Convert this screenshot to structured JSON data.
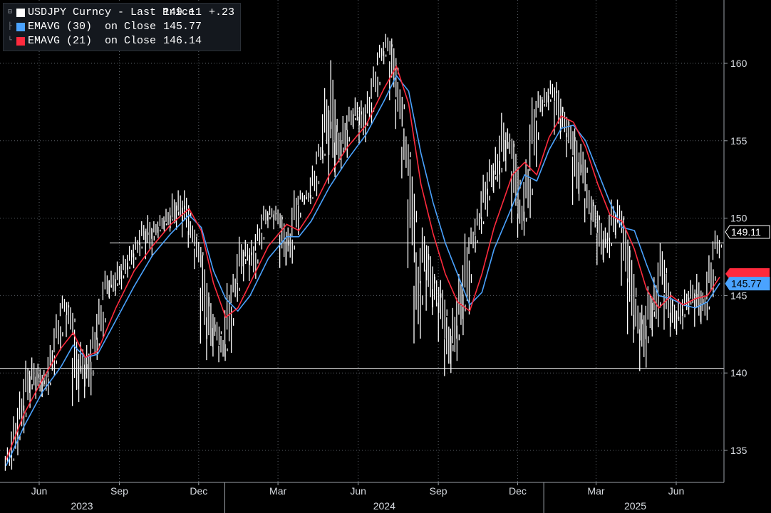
{
  "legend": {
    "rows": [
      {
        "name": "USDJPY Curncy - Last Price",
        "value": "149.11",
        "change": "+.23",
        "color": "#ffffff"
      },
      {
        "name": "EMAVG (30)  on Close",
        "value": "145.77",
        "change": "",
        "color": "#4aa3ff"
      },
      {
        "name": "EMAVG (21)  on Close",
        "value": "146.14",
        "change": "",
        "color": "#ff2a3d"
      }
    ]
  },
  "price_tag": {
    "last": "149.11",
    "ema30": "145.77"
  },
  "chart_data": {
    "type": "line",
    "title": "",
    "xlabel": "",
    "ylabel": "",
    "ylim": [
      133,
      163
    ],
    "y_ticks": [
      135,
      140,
      145,
      150,
      155,
      160
    ],
    "x_month_ticks": [
      {
        "label": "Jun",
        "date": "2023-06-01"
      },
      {
        "label": "Sep",
        "date": "2023-09-01"
      },
      {
        "label": "Dec",
        "date": "2023-12-01"
      },
      {
        "label": "Mar",
        "date": "2024-03-01"
      },
      {
        "label": "Jun",
        "date": "2024-06-01"
      },
      {
        "label": "Sep",
        "date": "2024-09-01"
      },
      {
        "label": "Dec",
        "date": "2024-12-01"
      },
      {
        "label": "Mar",
        "date": "2025-03-01"
      },
      {
        "label": "Jun",
        "date": "2025-06-01"
      }
    ],
    "x_year_labels": [
      {
        "label": "2023",
        "date": "2023-07-20"
      },
      {
        "label": "2024",
        "date": "2024-07-01"
      },
      {
        "label": "2025",
        "date": "2025-04-15"
      }
    ],
    "x_range": [
      "2023-04-24",
      "2025-07-31"
    ],
    "reference_lines": [
      148.4,
      140.3
    ],
    "grid": true,
    "legend_position": "top-left",
    "series": [
      {
        "name": "USDJPY Curncy - Last Price",
        "style": "hi-lo bars",
        "color": "#ffffff",
        "points": [
          [
            "2023-04-28",
            135.2,
            133.6
          ],
          [
            "2023-05-05",
            137.2,
            134.4
          ],
          [
            "2023-05-12",
            138.8,
            135.8
          ],
          [
            "2023-05-19",
            140.8,
            137.4
          ],
          [
            "2023-05-26",
            141.0,
            138.6
          ],
          [
            "2023-06-02",
            140.6,
            138.2
          ],
          [
            "2023-06-09",
            140.2,
            138.4
          ],
          [
            "2023-06-16",
            141.8,
            139.6
          ],
          [
            "2023-06-23",
            143.8,
            141.2
          ],
          [
            "2023-06-30",
            145.0,
            143.6
          ],
          [
            "2023-07-07",
            144.6,
            142.2
          ],
          [
            "2023-07-14",
            142.8,
            137.6
          ],
          [
            "2023-07-21",
            142.0,
            138.8
          ],
          [
            "2023-07-28",
            141.8,
            138.2
          ],
          [
            "2023-08-04",
            143.0,
            140.6
          ],
          [
            "2023-08-11",
            144.8,
            142.0
          ],
          [
            "2023-08-18",
            146.6,
            144.6
          ],
          [
            "2023-08-25",
            146.6,
            144.8
          ],
          [
            "2023-09-01",
            147.2,
            145.2
          ],
          [
            "2023-09-08",
            147.6,
            146.0
          ],
          [
            "2023-09-15",
            148.2,
            146.6
          ],
          [
            "2023-09-22",
            148.8,
            147.4
          ],
          [
            "2023-09-29",
            149.8,
            148.2
          ],
          [
            "2023-10-06",
            150.2,
            147.2
          ],
          [
            "2023-10-13",
            149.8,
            148.6
          ],
          [
            "2023-10-20",
            150.2,
            149.0
          ],
          [
            "2023-10-27",
            150.6,
            149.2
          ],
          [
            "2023-11-03",
            151.6,
            149.0
          ],
          [
            "2023-11-10",
            151.8,
            149.6
          ],
          [
            "2023-11-17",
            151.8,
            148.6
          ],
          [
            "2023-11-24",
            149.8,
            148.0
          ],
          [
            "2023-12-01",
            148.8,
            146.6
          ],
          [
            "2023-12-08",
            147.6,
            141.6
          ],
          [
            "2023-12-15",
            145.2,
            140.6
          ],
          [
            "2023-12-22",
            143.6,
            141.6
          ],
          [
            "2023-12-29",
            142.4,
            140.6
          ],
          [
            "2024-01-05",
            145.8,
            140.8
          ],
          [
            "2024-01-12",
            146.4,
            144.4
          ],
          [
            "2024-01-19",
            148.8,
            145.6
          ],
          [
            "2024-01-26",
            148.6,
            146.8
          ],
          [
            "2024-02-02",
            148.6,
            145.8
          ],
          [
            "2024-02-09",
            149.6,
            147.8
          ],
          [
            "2024-02-16",
            150.8,
            149.2
          ],
          [
            "2024-02-23",
            150.8,
            149.8
          ],
          [
            "2024-03-01",
            150.8,
            149.2
          ],
          [
            "2024-03-08",
            150.2,
            146.6
          ],
          [
            "2024-03-15",
            149.4,
            146.8
          ],
          [
            "2024-03-22",
            151.8,
            148.6
          ],
          [
            "2024-03-29",
            151.8,
            150.8
          ],
          [
            "2024-04-05",
            151.8,
            150.8
          ],
          [
            "2024-04-12",
            153.4,
            151.2
          ],
          [
            "2024-04-19",
            154.8,
            153.4
          ],
          [
            "2024-04-26",
            158.4,
            153.6
          ],
          [
            "2024-05-03",
            160.2,
            151.8
          ],
          [
            "2024-05-10",
            156.0,
            152.8
          ],
          [
            "2024-05-17",
            156.6,
            153.6
          ],
          [
            "2024-05-24",
            157.2,
            155.6
          ],
          [
            "2024-05-31",
            157.8,
            155.8
          ],
          [
            "2024-06-07",
            157.6,
            154.6
          ],
          [
            "2024-06-14",
            158.2,
            155.8
          ],
          [
            "2024-06-21",
            159.8,
            157.6
          ],
          [
            "2024-06-28",
            161.2,
            159.8
          ],
          [
            "2024-07-05",
            161.9,
            160.4
          ],
          [
            "2024-07-12",
            161.6,
            157.4
          ],
          [
            "2024-07-19",
            158.8,
            155.6
          ],
          [
            "2024-07-26",
            155.8,
            152.4
          ],
          [
            "2024-08-02",
            153.8,
            146.4
          ],
          [
            "2024-08-09",
            147.8,
            141.6
          ],
          [
            "2024-08-16",
            149.4,
            145.6
          ],
          [
            "2024-08-23",
            148.2,
            143.8
          ],
          [
            "2024-08-30",
            146.4,
            143.6
          ],
          [
            "2024-09-06",
            146.0,
            141.8
          ],
          [
            "2024-09-13",
            143.6,
            139.6
          ],
          [
            "2024-09-20",
            144.2,
            140.4
          ],
          [
            "2024-09-27",
            146.4,
            142.0
          ],
          [
            "2024-10-04",
            149.0,
            143.2
          ],
          [
            "2024-10-11",
            149.4,
            147.6
          ],
          [
            "2024-10-18",
            150.6,
            148.8
          ],
          [
            "2024-10-25",
            152.8,
            149.8
          ],
          [
            "2024-11-01",
            153.8,
            151.4
          ],
          [
            "2024-11-08",
            154.6,
            151.6
          ],
          [
            "2024-11-15",
            156.8,
            152.6
          ],
          [
            "2024-11-22",
            155.8,
            153.6
          ],
          [
            "2024-11-29",
            155.0,
            149.4
          ],
          [
            "2024-12-06",
            151.2,
            148.6
          ],
          [
            "2024-12-13",
            153.8,
            149.6
          ],
          [
            "2024-12-20",
            157.8,
            152.8
          ],
          [
            "2024-12-27",
            158.2,
            156.4
          ],
          [
            "2025-01-03",
            158.4,
            156.8
          ],
          [
            "2025-01-10",
            158.9,
            157.4
          ],
          [
            "2025-01-17",
            158.8,
            155.2
          ],
          [
            "2025-01-24",
            157.2,
            155.0
          ],
          [
            "2025-01-31",
            156.4,
            153.8
          ],
          [
            "2025-02-07",
            155.8,
            150.6
          ],
          [
            "2025-02-14",
            154.8,
            151.4
          ],
          [
            "2025-02-21",
            152.2,
            149.6
          ],
          [
            "2025-02-28",
            151.2,
            148.8
          ],
          [
            "2025-03-07",
            150.2,
            146.8
          ],
          [
            "2025-03-14",
            149.4,
            147.2
          ],
          [
            "2025-03-21",
            151.2,
            148.4
          ],
          [
            "2025-03-28",
            151.2,
            148.8
          ],
          [
            "2025-04-04",
            150.0,
            145.4
          ],
          [
            "2025-04-11",
            148.2,
            142.2
          ],
          [
            "2025-04-18",
            144.8,
            141.8
          ],
          [
            "2025-04-25",
            144.4,
            139.9
          ],
          [
            "2025-05-02",
            145.6,
            142.0
          ],
          [
            "2025-05-09",
            146.2,
            142.6
          ],
          [
            "2025-05-16",
            148.4,
            144.8
          ],
          [
            "2025-05-23",
            146.4,
            142.6
          ],
          [
            "2025-05-30",
            144.8,
            142.2
          ],
          [
            "2025-06-06",
            144.8,
            142.6
          ],
          [
            "2025-06-13",
            145.4,
            143.6
          ],
          [
            "2025-06-20",
            146.0,
            144.0
          ],
          [
            "2025-06-27",
            146.4,
            142.8
          ],
          [
            "2025-07-04",
            145.2,
            143.2
          ],
          [
            "2025-07-11",
            147.6,
            144.6
          ],
          [
            "2025-07-18",
            149.2,
            147.2
          ]
        ]
      },
      {
        "name": "EMAVG (30)  on Close",
        "style": "line",
        "color": "#4aa3ff",
        "points": [
          [
            "2023-04-24",
            134.0
          ],
          [
            "2023-05-15",
            136.6
          ],
          [
            "2023-06-05",
            138.8
          ],
          [
            "2023-06-26",
            140.4
          ],
          [
            "2023-07-10",
            141.8
          ],
          [
            "2023-07-24",
            141.0
          ],
          [
            "2023-08-07",
            141.2
          ],
          [
            "2023-08-28",
            143.4
          ],
          [
            "2023-09-18",
            145.6
          ],
          [
            "2023-10-09",
            147.6
          ],
          [
            "2023-10-30",
            149.0
          ],
          [
            "2023-11-20",
            150.2
          ],
          [
            "2023-12-04",
            149.4
          ],
          [
            "2023-12-18",
            146.6
          ],
          [
            "2024-01-01",
            144.8
          ],
          [
            "2024-01-15",
            144.0
          ],
          [
            "2024-01-29",
            145.0
          ],
          [
            "2024-02-19",
            147.4
          ],
          [
            "2024-03-11",
            148.8
          ],
          [
            "2024-03-25",
            148.8
          ],
          [
            "2024-04-08",
            149.8
          ],
          [
            "2024-04-29",
            152.0
          ],
          [
            "2024-05-20",
            153.8
          ],
          [
            "2024-06-10",
            155.4
          ],
          [
            "2024-07-01",
            157.6
          ],
          [
            "2024-07-15",
            159.2
          ],
          [
            "2024-07-29",
            158.2
          ],
          [
            "2024-08-12",
            154.2
          ],
          [
            "2024-08-26",
            151.0
          ],
          [
            "2024-09-09",
            148.4
          ],
          [
            "2024-09-23",
            146.4
          ],
          [
            "2024-10-07",
            144.4
          ],
          [
            "2024-10-21",
            145.2
          ],
          [
            "2024-11-04",
            148.0
          ],
          [
            "2024-11-25",
            150.8
          ],
          [
            "2024-12-09",
            152.8
          ],
          [
            "2024-12-23",
            152.4
          ],
          [
            "2025-01-06",
            154.4
          ],
          [
            "2025-01-20",
            155.8
          ],
          [
            "2025-02-03",
            156.0
          ],
          [
            "2025-02-17",
            155.0
          ],
          [
            "2025-03-03",
            153.0
          ],
          [
            "2025-03-17",
            151.0
          ],
          [
            "2025-03-31",
            149.4
          ],
          [
            "2025-04-14",
            149.2
          ],
          [
            "2025-04-28",
            147.0
          ],
          [
            "2025-05-12",
            145.0
          ],
          [
            "2025-05-26",
            144.8
          ],
          [
            "2025-06-09",
            144.4
          ],
          [
            "2025-06-23",
            144.2
          ],
          [
            "2025-07-07",
            144.6
          ],
          [
            "2025-07-21",
            145.8
          ]
        ]
      },
      {
        "name": "EMAVG (21)  on Close",
        "style": "line",
        "color": "#ff2a3d",
        "points": [
          [
            "2023-04-24",
            134.4
          ],
          [
            "2023-05-15",
            137.4
          ],
          [
            "2023-06-05",
            139.6
          ],
          [
            "2023-06-26",
            141.6
          ],
          [
            "2023-07-10",
            142.6
          ],
          [
            "2023-07-24",
            141.0
          ],
          [
            "2023-08-07",
            141.4
          ],
          [
            "2023-08-28",
            144.2
          ],
          [
            "2023-09-18",
            146.6
          ],
          [
            "2023-10-09",
            148.2
          ],
          [
            "2023-10-30",
            149.6
          ],
          [
            "2023-11-20",
            150.6
          ],
          [
            "2023-12-04",
            149.2
          ],
          [
            "2023-12-18",
            145.8
          ],
          [
            "2024-01-01",
            143.6
          ],
          [
            "2024-01-15",
            144.2
          ],
          [
            "2024-01-29",
            145.8
          ],
          [
            "2024-02-19",
            148.2
          ],
          [
            "2024-03-11",
            149.6
          ],
          [
            "2024-03-25",
            149.2
          ],
          [
            "2024-04-08",
            150.4
          ],
          [
            "2024-04-29",
            152.8
          ],
          [
            "2024-05-20",
            154.6
          ],
          [
            "2024-06-10",
            156.0
          ],
          [
            "2024-07-01",
            158.4
          ],
          [
            "2024-07-15",
            159.8
          ],
          [
            "2024-07-29",
            157.4
          ],
          [
            "2024-08-12",
            152.2
          ],
          [
            "2024-08-26",
            149.0
          ],
          [
            "2024-09-09",
            146.4
          ],
          [
            "2024-09-23",
            144.6
          ],
          [
            "2024-10-07",
            144.0
          ],
          [
            "2024-10-21",
            146.4
          ],
          [
            "2024-11-04",
            149.4
          ],
          [
            "2024-11-25",
            152.8
          ],
          [
            "2024-12-09",
            153.6
          ],
          [
            "2024-12-23",
            152.8
          ],
          [
            "2025-01-06",
            155.2
          ],
          [
            "2025-01-20",
            156.6
          ],
          [
            "2025-02-03",
            156.2
          ],
          [
            "2025-02-17",
            154.6
          ],
          [
            "2025-03-03",
            152.2
          ],
          [
            "2025-03-17",
            150.2
          ],
          [
            "2025-03-31",
            149.8
          ],
          [
            "2025-04-14",
            148.0
          ],
          [
            "2025-04-28",
            145.4
          ],
          [
            "2025-05-12",
            144.2
          ],
          [
            "2025-05-26",
            145.0
          ],
          [
            "2025-06-09",
            144.4
          ],
          [
            "2025-06-23",
            144.8
          ],
          [
            "2025-07-07",
            145.0
          ],
          [
            "2025-07-21",
            146.2
          ]
        ]
      }
    ]
  }
}
